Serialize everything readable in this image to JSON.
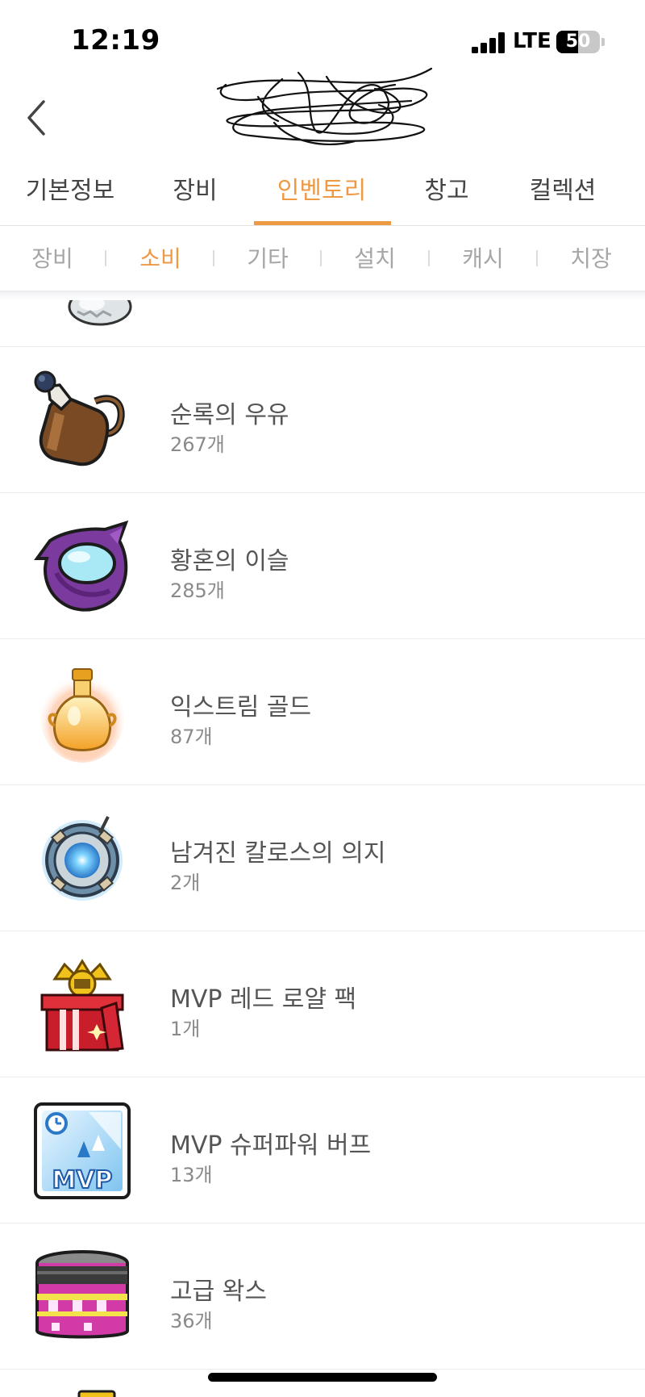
{
  "status_bar": {
    "time": "12:19",
    "network": "LTE",
    "battery": "50",
    "battery_level": 0.5
  },
  "header": {
    "back_icon": "chevron-left-icon",
    "title_icon": "scribbled-out-title"
  },
  "main_tabs": [
    {
      "label": "기본정보",
      "active": false
    },
    {
      "label": "장비",
      "active": false
    },
    {
      "label": "인벤토리",
      "active": true
    },
    {
      "label": "창고",
      "active": false
    },
    {
      "label": "컬렉션",
      "active": false
    }
  ],
  "sub_tabs": [
    {
      "label": "장비",
      "active": false
    },
    {
      "label": "소비",
      "active": true
    },
    {
      "label": "기타",
      "active": false
    },
    {
      "label": "설치",
      "active": false
    },
    {
      "label": "캐시",
      "active": false
    },
    {
      "label": "치장",
      "active": false
    }
  ],
  "items": [
    {
      "name": "순록의 우유",
      "count": "267개",
      "icon": "milk-jug-icon"
    },
    {
      "name": "황혼의 이슬",
      "count": "285개",
      "icon": "purple-dew-icon"
    },
    {
      "name": "익스트림 골드",
      "count": "87개",
      "icon": "gold-potion-icon"
    },
    {
      "name": "남겨진 칼로스의 의지",
      "count": "2개",
      "icon": "kalos-orb-icon"
    },
    {
      "name": "MVP 레드 로얄 팩",
      "count": "1개",
      "icon": "red-royal-gift-icon"
    },
    {
      "name": "MVP 슈퍼파워 버프",
      "count": "13개",
      "icon": "mvp-buff-icon"
    },
    {
      "name": "고급 왁스",
      "count": "36개",
      "icon": "wax-can-icon"
    }
  ],
  "colors": {
    "accent": "#ee9a45",
    "tab_text": "#444444",
    "sub_tab_inactive": "#a6a6a6",
    "item_name": "#555555",
    "item_count": "#8a8a8a",
    "divider": "#ececec"
  }
}
